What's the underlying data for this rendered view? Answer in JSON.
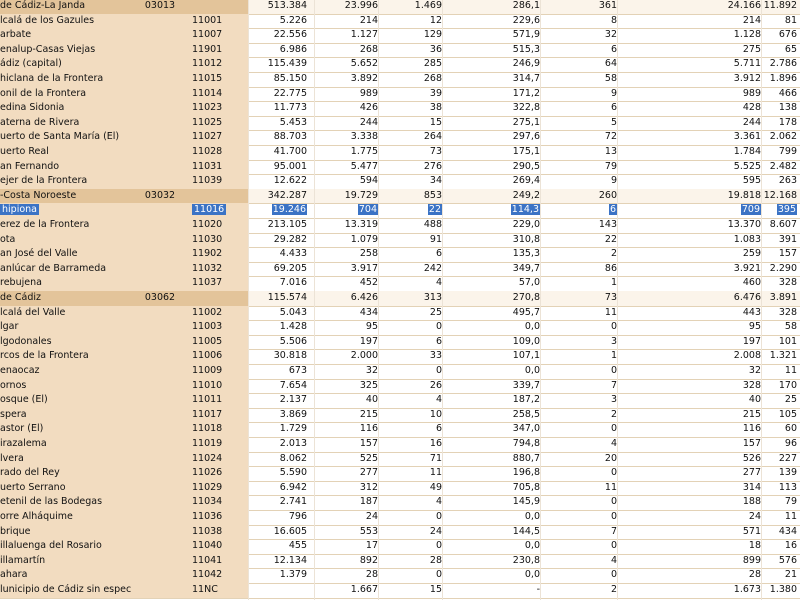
{
  "rows": [
    {
      "name": "de Cádiz-La Janda",
      "parent": "03013",
      "code": "",
      "v": [
        "513.384",
        "23.996",
        "1.469",
        "286,1",
        "361",
        "24.166",
        "11.892"
      ],
      "type": "agg"
    },
    {
      "name": "lcalá de los Gazules",
      "parent": "",
      "code": "11001",
      "v": [
        "5.226",
        "214",
        "12",
        "229,6",
        "8",
        "214",
        "81"
      ],
      "type": "normal"
    },
    {
      "name": "arbate",
      "parent": "",
      "code": "11007",
      "v": [
        "22.556",
        "1.127",
        "129",
        "571,9",
        "32",
        "1.128",
        "676"
      ],
      "type": "normal"
    },
    {
      "name": "enalup-Casas Viejas",
      "parent": "",
      "code": "11901",
      "v": [
        "6.986",
        "268",
        "36",
        "515,3",
        "6",
        "275",
        "65"
      ],
      "type": "normal"
    },
    {
      "name": "ádiz (capital)",
      "parent": "",
      "code": "11012",
      "v": [
        "115.439",
        "5.652",
        "285",
        "246,9",
        "64",
        "5.711",
        "2.786"
      ],
      "type": "normal"
    },
    {
      "name": "hiclana de la Frontera",
      "parent": "",
      "code": "11015",
      "v": [
        "85.150",
        "3.892",
        "268",
        "314,7",
        "58",
        "3.912",
        "1.896"
      ],
      "type": "normal"
    },
    {
      "name": "onil de la Frontera",
      "parent": "",
      "code": "11014",
      "v": [
        "22.775",
        "989",
        "39",
        "171,2",
        "9",
        "989",
        "466"
      ],
      "type": "normal"
    },
    {
      "name": "edina Sidonia",
      "parent": "",
      "code": "11023",
      "v": [
        "11.773",
        "426",
        "38",
        "322,8",
        "6",
        "428",
        "138"
      ],
      "type": "normal"
    },
    {
      "name": "aterna de Rivera",
      "parent": "",
      "code": "11025",
      "v": [
        "5.453",
        "244",
        "15",
        "275,1",
        "5",
        "244",
        "178"
      ],
      "type": "normal"
    },
    {
      "name": "uerto de Santa María (El)",
      "parent": "",
      "code": "11027",
      "v": [
        "88.703",
        "3.338",
        "264",
        "297,6",
        "72",
        "3.361",
        "2.062"
      ],
      "type": "normal"
    },
    {
      "name": "uerto Real",
      "parent": "",
      "code": "11028",
      "v": [
        "41.700",
        "1.775",
        "73",
        "175,1",
        "13",
        "1.784",
        "799"
      ],
      "type": "normal"
    },
    {
      "name": "an Fernando",
      "parent": "",
      "code": "11031",
      "v": [
        "95.001",
        "5.477",
        "276",
        "290,5",
        "79",
        "5.525",
        "2.482"
      ],
      "type": "normal"
    },
    {
      "name": "ejer de la Frontera",
      "parent": "",
      "code": "11039",
      "v": [
        "12.622",
        "594",
        "34",
        "269,4",
        "9",
        "595",
        "263"
      ],
      "type": "normal"
    },
    {
      "name": "-Costa Noroeste",
      "parent": "03032",
      "code": "",
      "v": [
        "342.287",
        "19.729",
        "853",
        "249,2",
        "260",
        "19.818",
        "12.168"
      ],
      "type": "agg"
    },
    {
      "name": "hipiona",
      "parent": "",
      "code": "11016",
      "v": [
        "19.246",
        "704",
        "22",
        "114,3",
        "6",
        "709",
        "395"
      ],
      "type": "sel"
    },
    {
      "name": "erez de la Frontera",
      "parent": "",
      "code": "11020",
      "v": [
        "213.105",
        "13.319",
        "488",
        "229,0",
        "143",
        "13.370",
        "8.607"
      ],
      "type": "normal"
    },
    {
      "name": "ota",
      "parent": "",
      "code": "11030",
      "v": [
        "29.282",
        "1.079",
        "91",
        "310,8",
        "22",
        "1.083",
        "391"
      ],
      "type": "normal"
    },
    {
      "name": "an José del Valle",
      "parent": "",
      "code": "11902",
      "v": [
        "4.433",
        "258",
        "6",
        "135,3",
        "2",
        "259",
        "157"
      ],
      "type": "normal"
    },
    {
      "name": "anlúcar de Barrameda",
      "parent": "",
      "code": "11032",
      "v": [
        "69.205",
        "3.917",
        "242",
        "349,7",
        "86",
        "3.921",
        "2.290"
      ],
      "type": "normal"
    },
    {
      "name": "rebujena",
      "parent": "",
      "code": "11037",
      "v": [
        "7.016",
        "452",
        "4",
        "57,0",
        "1",
        "460",
        "328"
      ],
      "type": "normal"
    },
    {
      "name": "de Cádiz",
      "parent": "03062",
      "code": "",
      "v": [
        "115.574",
        "6.426",
        "313",
        "270,8",
        "73",
        "6.476",
        "3.891"
      ],
      "type": "agg"
    },
    {
      "name": "lcalá del Valle",
      "parent": "",
      "code": "11002",
      "v": [
        "5.043",
        "434",
        "25",
        "495,7",
        "11",
        "443",
        "328"
      ],
      "type": "normal"
    },
    {
      "name": "lgar",
      "parent": "",
      "code": "11003",
      "v": [
        "1.428",
        "95",
        "0",
        "0,0",
        "0",
        "95",
        "58"
      ],
      "type": "normal"
    },
    {
      "name": "lgodonales",
      "parent": "",
      "code": "11005",
      "v": [
        "5.506",
        "197",
        "6",
        "109,0",
        "3",
        "197",
        "101"
      ],
      "type": "normal"
    },
    {
      "name": "rcos de la Frontera",
      "parent": "",
      "code": "11006",
      "v": [
        "30.818",
        "2.000",
        "33",
        "107,1",
        "1",
        "2.008",
        "1.321"
      ],
      "type": "normal"
    },
    {
      "name": "enaocaz",
      "parent": "",
      "code": "11009",
      "v": [
        "673",
        "32",
        "0",
        "0,0",
        "0",
        "32",
        "11"
      ],
      "type": "normal"
    },
    {
      "name": "ornos",
      "parent": "",
      "code": "11010",
      "v": [
        "7.654",
        "325",
        "26",
        "339,7",
        "7",
        "328",
        "170"
      ],
      "type": "normal"
    },
    {
      "name": "osque (El)",
      "parent": "",
      "code": "11011",
      "v": [
        "2.137",
        "40",
        "4",
        "187,2",
        "3",
        "40",
        "25"
      ],
      "type": "normal"
    },
    {
      "name": "spera",
      "parent": "",
      "code": "11017",
      "v": [
        "3.869",
        "215",
        "10",
        "258,5",
        "2",
        "215",
        "105"
      ],
      "type": "normal"
    },
    {
      "name": "astor (El)",
      "parent": "",
      "code": "11018",
      "v": [
        "1.729",
        "116",
        "6",
        "347,0",
        "0",
        "116",
        "60"
      ],
      "type": "normal"
    },
    {
      "name": "irazalema",
      "parent": "",
      "code": "11019",
      "v": [
        "2.013",
        "157",
        "16",
        "794,8",
        "4",
        "157",
        "96"
      ],
      "type": "normal"
    },
    {
      "name": "lvera",
      "parent": "",
      "code": "11024",
      "v": [
        "8.062",
        "525",
        "71",
        "880,7",
        "20",
        "526",
        "227"
      ],
      "type": "normal"
    },
    {
      "name": "rado del Rey",
      "parent": "",
      "code": "11026",
      "v": [
        "5.590",
        "277",
        "11",
        "196,8",
        "0",
        "277",
        "139"
      ],
      "type": "normal"
    },
    {
      "name": "uerto Serrano",
      "parent": "",
      "code": "11029",
      "v": [
        "6.942",
        "312",
        "49",
        "705,8",
        "11",
        "314",
        "113"
      ],
      "type": "normal"
    },
    {
      "name": "etenil de las Bodegas",
      "parent": "",
      "code": "11034",
      "v": [
        "2.741",
        "187",
        "4",
        "145,9",
        "0",
        "188",
        "79"
      ],
      "type": "normal"
    },
    {
      "name": "orre Alháquime",
      "parent": "",
      "code": "11036",
      "v": [
        "796",
        "24",
        "0",
        "0,0",
        "0",
        "24",
        "11"
      ],
      "type": "normal"
    },
    {
      "name": "brique",
      "parent": "",
      "code": "11038",
      "v": [
        "16.605",
        "553",
        "24",
        "144,5",
        "7",
        "571",
        "434"
      ],
      "type": "normal"
    },
    {
      "name": "illaluenga del Rosario",
      "parent": "",
      "code": "11040",
      "v": [
        "455",
        "17",
        "0",
        "0,0",
        "0",
        "18",
        "16"
      ],
      "type": "normal"
    },
    {
      "name": "illamartín",
      "parent": "",
      "code": "11041",
      "v": [
        "12.134",
        "892",
        "28",
        "230,8",
        "4",
        "899",
        "576"
      ],
      "type": "normal"
    },
    {
      "name": "ahara",
      "parent": "",
      "code": "11042",
      "v": [
        "1.379",
        "28",
        "0",
        "0,0",
        "0",
        "28",
        "21"
      ],
      "type": "normal"
    },
    {
      "name": "lunicipio de Cádiz sin especificar",
      "parent": "",
      "code": "11NC",
      "v": [
        "",
        "1.667",
        "15",
        "-",
        "2",
        "1.673",
        "1.380"
      ],
      "type": "normal"
    }
  ]
}
